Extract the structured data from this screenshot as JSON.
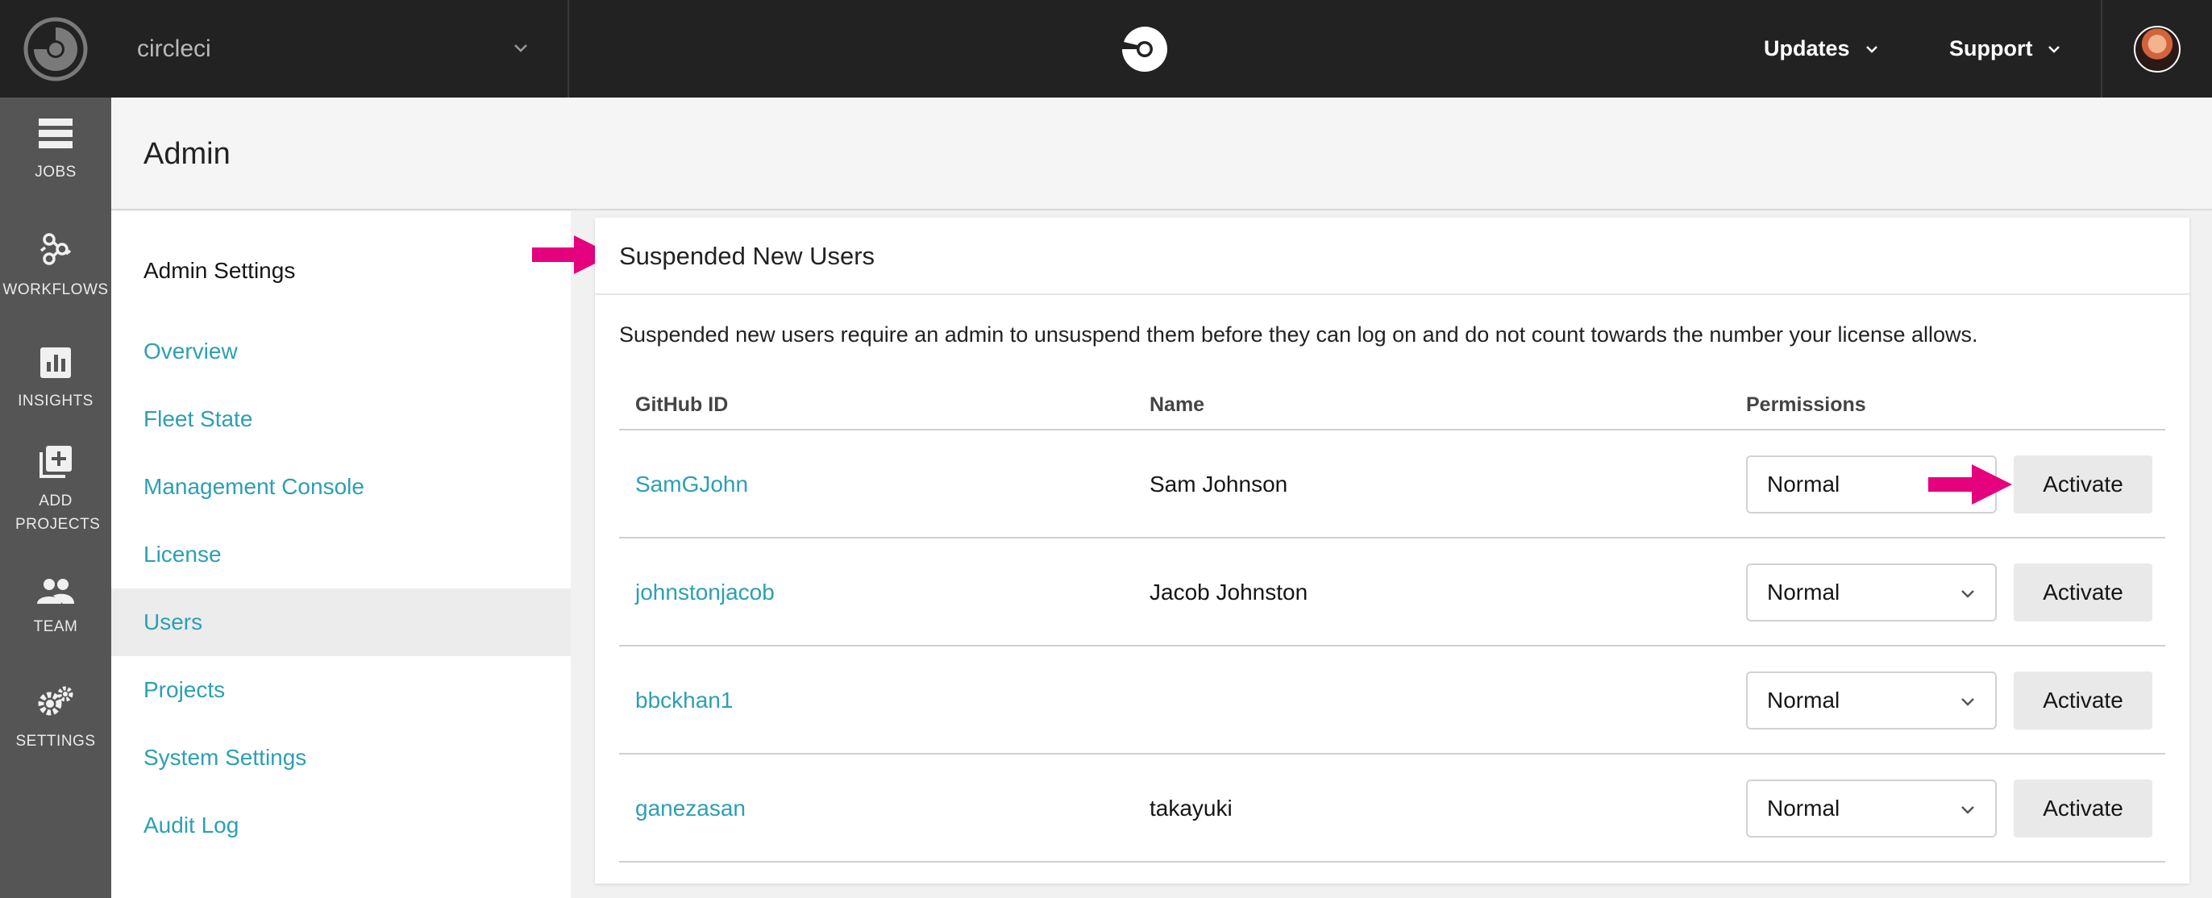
{
  "topbar": {
    "org_name": "circleci",
    "updates_label": "Updates",
    "support_label": "Support"
  },
  "rail": {
    "items": [
      {
        "label": "JOBS",
        "icon": "jobs-icon"
      },
      {
        "label": "WORKFLOWS",
        "icon": "workflows-icon"
      },
      {
        "label": "INSIGHTS",
        "icon": "insights-icon"
      },
      {
        "label": "ADD PROJECTS",
        "icon": "add-projects-icon"
      },
      {
        "label": "TEAM",
        "icon": "team-icon"
      },
      {
        "label": "SETTINGS",
        "icon": "settings-icon"
      }
    ]
  },
  "page": {
    "title": "Admin"
  },
  "settings_nav": {
    "heading": "Admin Settings",
    "items": [
      "Overview",
      "Fleet State",
      "Management Console",
      "License",
      "Users",
      "Projects",
      "System Settings",
      "Audit Log"
    ],
    "active": "Users"
  },
  "panel": {
    "title": "Suspended New Users",
    "description": "Suspended new users require an admin to unsuspend them before they can log on and do not count towards the number your license allows.",
    "columns": [
      "GitHub ID",
      "Name",
      "Permissions"
    ],
    "rows": [
      {
        "github_id": "SamGJohn",
        "name": "Sam Johnson",
        "permission": "Normal",
        "action": "Activate"
      },
      {
        "github_id": "johnstonjacob",
        "name": "Jacob Johnston",
        "permission": "Normal",
        "action": "Activate"
      },
      {
        "github_id": "bbckhan1",
        "name": "",
        "permission": "Normal",
        "action": "Activate"
      },
      {
        "github_id": "ganezasan",
        "name": "takayuki",
        "permission": "Normal",
        "action": "Activate"
      }
    ]
  },
  "colors": {
    "topbar": "#222222",
    "rail": "#555555",
    "link": "#2d9fb3",
    "annotation_arrow": "#e5007e"
  }
}
